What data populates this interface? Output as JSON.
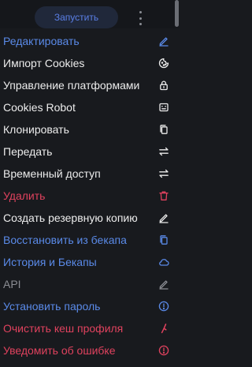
{
  "toolbar": {
    "launch_label": "Запустить",
    "more_icon": "kebab-vertical-icon"
  },
  "colors": {
    "background": "#181a1e",
    "blue": "#5a8ae8",
    "white": "#ececec",
    "red": "#e0425e",
    "gray": "#8b8d93"
  },
  "menu": {
    "items": [
      {
        "label": "Редактировать",
        "icon": "pencil-icon",
        "color": "blue"
      },
      {
        "label": "Импорт Cookies",
        "icon": "cookie-icon",
        "color": "white"
      },
      {
        "label": "Управление платформами",
        "icon": "lock-icon",
        "color": "white"
      },
      {
        "label": "Cookies Robot",
        "icon": "robot-icon",
        "color": "white"
      },
      {
        "label": "Клонировать",
        "icon": "copy-icon",
        "color": "white"
      },
      {
        "label": "Передать",
        "icon": "transfer-icon",
        "color": "white"
      },
      {
        "label": "Временный доступ",
        "icon": "transfer-icon",
        "color": "white"
      },
      {
        "label": "Удалить",
        "icon": "trash-icon",
        "color": "red"
      },
      {
        "label": "Создать резервную копию",
        "icon": "pencil-icon",
        "color": "white"
      },
      {
        "label": "Восстановить из бекапа",
        "icon": "copy-icon",
        "color": "blue"
      },
      {
        "label": "История и Бекапы",
        "icon": "cloud-icon",
        "color": "blue"
      },
      {
        "label": "API",
        "icon": "pencil-icon",
        "color": "gray"
      },
      {
        "label": "Установить пароль",
        "icon": "info-icon",
        "color": "blue"
      },
      {
        "label": "Очистить кеш профиля",
        "icon": "broom-icon",
        "color": "red"
      },
      {
        "label": "Уведомить об ошибке",
        "icon": "info-icon",
        "color": "red"
      }
    ]
  }
}
